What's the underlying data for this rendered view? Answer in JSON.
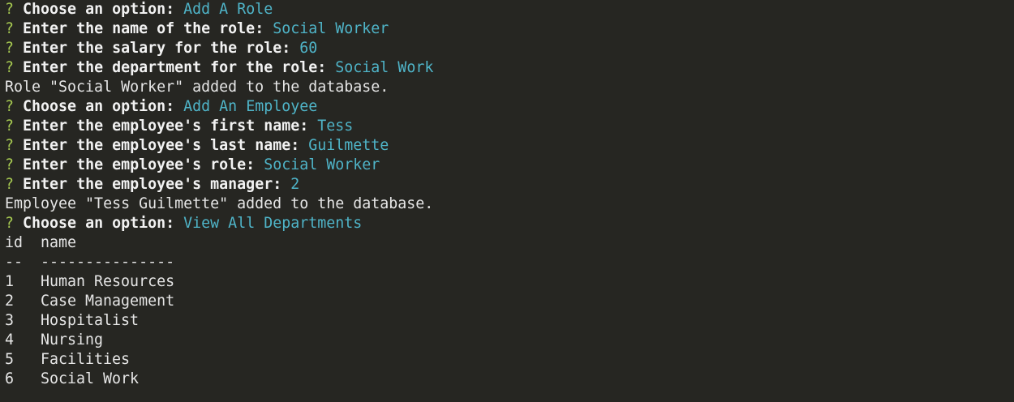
{
  "prompt_marker": "?",
  "colors": {
    "background": "#262622",
    "prompt_marker": "#a6c951",
    "answer": "#4fb4c8",
    "text": "#e6e6e6"
  },
  "session": [
    {
      "type": "prompt",
      "label": "Choose an option:",
      "answer": "Add A Role"
    },
    {
      "type": "prompt",
      "label": "Enter the name of the role:",
      "answer": "Social Worker"
    },
    {
      "type": "prompt",
      "label": "Enter the salary for the role:",
      "answer": "60"
    },
    {
      "type": "prompt",
      "label": "Enter the department for the role:",
      "answer": "Social Work"
    },
    {
      "type": "output",
      "text": "Role \"Social Worker\" added to the database."
    },
    {
      "type": "prompt",
      "label": "Choose an option:",
      "answer": "Add An Employee"
    },
    {
      "type": "prompt",
      "label": "Enter the employee's first name:",
      "answer": "Tess"
    },
    {
      "type": "prompt",
      "label": "Enter the employee's last name:",
      "answer": "Guilmette"
    },
    {
      "type": "prompt",
      "label": "Enter the employee's role:",
      "answer": "Social Worker"
    },
    {
      "type": "prompt",
      "label": "Enter the employee's manager:",
      "answer": "2"
    },
    {
      "type": "output",
      "text": "Employee \"Tess Guilmette\" added to the database."
    },
    {
      "type": "prompt",
      "label": "Choose an option:",
      "answer": "View All Departments"
    }
  ],
  "table": {
    "header_id": "id",
    "header_name": "name",
    "separator_id": "--",
    "separator_name": "---------------",
    "rows": [
      {
        "id": "1",
        "name": "Human Resources"
      },
      {
        "id": "2",
        "name": "Case Management"
      },
      {
        "id": "3",
        "name": "Hospitalist"
      },
      {
        "id": "4",
        "name": "Nursing"
      },
      {
        "id": "5",
        "name": "Facilities"
      },
      {
        "id": "6",
        "name": "Social Work"
      }
    ]
  }
}
